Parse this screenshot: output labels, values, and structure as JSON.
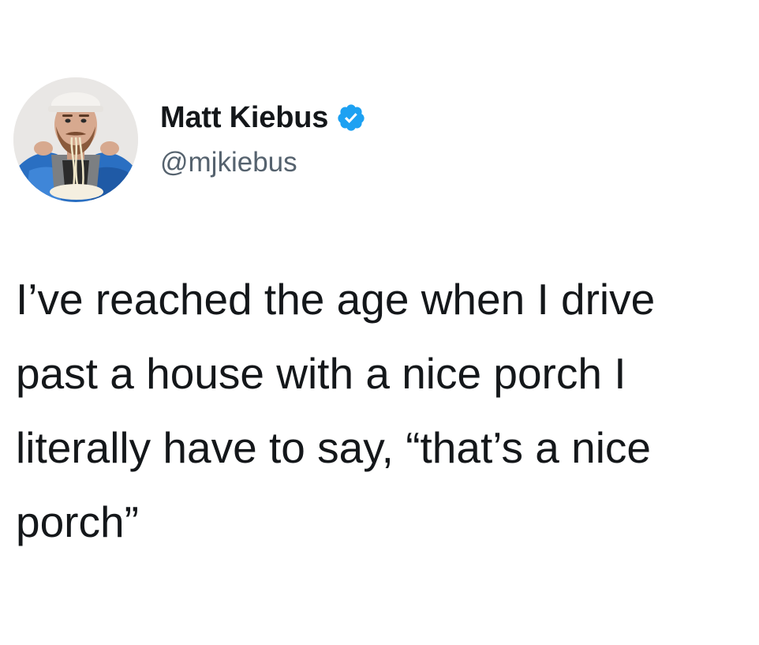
{
  "user": {
    "display_name": "Matt Kiebus",
    "handle": "@mjkiebus",
    "verified_icon": "verified-badge-icon",
    "avatar_icon": "profile-photo"
  },
  "tweet": {
    "lines": [
      "I’ve reached the age when I drive",
      "past a house with a nice porch I",
      "literally have to say, “that’s a nice",
      "porch”"
    ]
  },
  "colors": {
    "text": "#14171a",
    "handle": "#55626e",
    "verified": "#1da1f2",
    "background": "#ffffff"
  }
}
